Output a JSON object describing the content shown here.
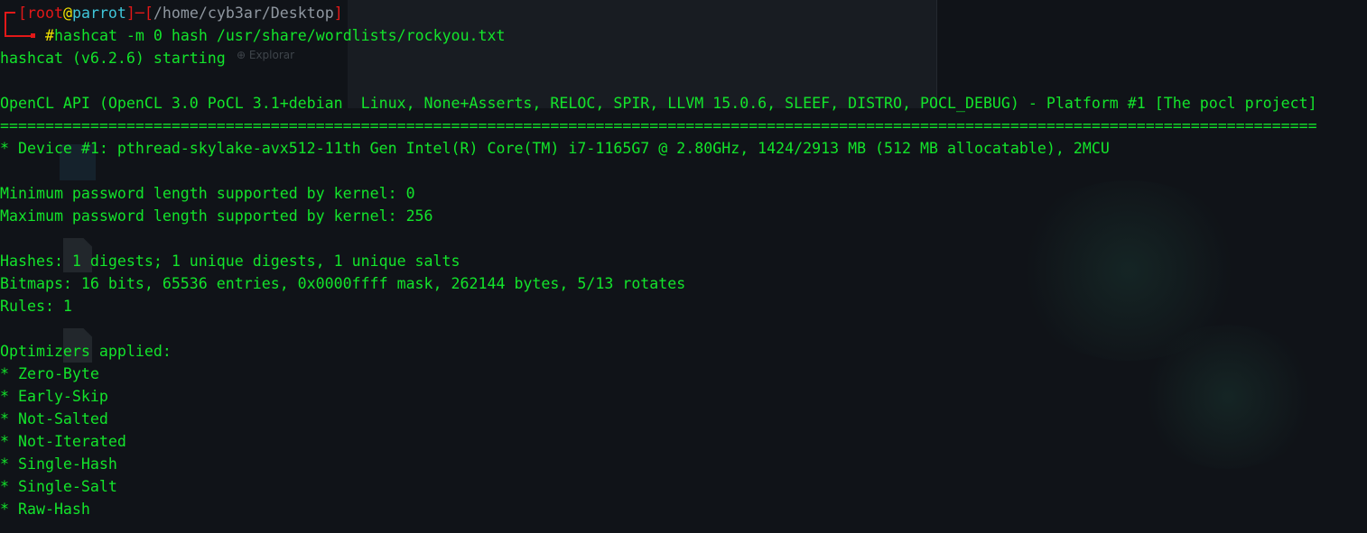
{
  "prompt": {
    "open_bracket": "[",
    "user": "root",
    "at": "@",
    "host": "parrot",
    "close_bracket": "]",
    "separator": "─",
    "path_open": "[",
    "path": "/home/cyb3ar/Desktop",
    "path_close": "]",
    "symbol": "#",
    "command": "hashcat -m 0 hash /usr/share/wordlists/rockyou.txt"
  },
  "background": {
    "explorar_label": "⊕ Explorar"
  },
  "output": [
    "hashcat (v6.2.6) starting",
    "",
    "OpenCL API (OpenCL 3.0 PoCL 3.1+debian  Linux, None+Asserts, RELOC, SPIR, LLVM 15.0.6, SLEEF, DISTRO, POCL_DEBUG) - Platform #1 [The pocl project]",
    "==================================================================================================================================================",
    "* Device #1: pthread-skylake-avx512-11th Gen Intel(R) Core(TM) i7-1165G7 @ 2.80GHz, 1424/2913 MB (512 MB allocatable), 2MCU",
    "",
    "Minimum password length supported by kernel: 0",
    "Maximum password length supported by kernel: 256",
    "",
    "Hashes: 1 digests; 1 unique digests, 1 unique salts",
    "Bitmaps: 16 bits, 65536 entries, 0x0000ffff mask, 262144 bytes, 5/13 rotates",
    "Rules: 1",
    "",
    "Optimizers applied:",
    "* Zero-Byte",
    "* Early-Skip",
    "* Not-Salted",
    "* Not-Iterated",
    "* Single-Hash",
    "* Single-Salt",
    "* Raw-Hash"
  ],
  "colors": {
    "output_green": "#13e42b",
    "prompt_red": "#e21818",
    "host_cyan": "#3fc6d9",
    "symbol_yellow": "#f2e200",
    "background": "#101318"
  }
}
